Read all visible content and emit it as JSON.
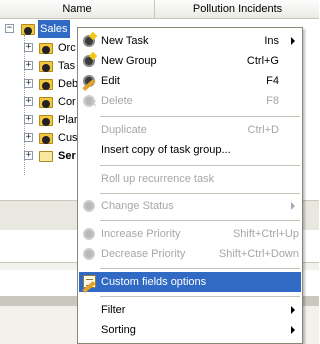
{
  "header": {
    "col_name": "Name",
    "col_pollution": "Pollution Incidents"
  },
  "tree": {
    "root_label": "Sales",
    "children": [
      {
        "label": "Orc",
        "bold": false
      },
      {
        "label": "Tas",
        "bold": false
      },
      {
        "label": "Deb",
        "bold": false
      },
      {
        "label": "Cor",
        "bold": false
      },
      {
        "label": "Plar",
        "bold": false
      },
      {
        "label": "Cus",
        "bold": false
      },
      {
        "label": "Ser",
        "bold": true
      }
    ]
  },
  "menu": {
    "new_task": {
      "label": "New Task",
      "shortcut": "Ins"
    },
    "new_group": {
      "label": "New Group",
      "shortcut": "Ctrl+G"
    },
    "edit": {
      "label": "Edit",
      "shortcut": "F4"
    },
    "delete": {
      "label": "Delete",
      "shortcut": "F8"
    },
    "duplicate": {
      "label": "Duplicate",
      "shortcut": "Ctrl+D"
    },
    "insert_copy": {
      "label": "Insert copy of task group..."
    },
    "roll_up": {
      "label": "Roll up recurrence task"
    },
    "change_status": {
      "label": "Change Status"
    },
    "increase_priority": {
      "label": "Increase Priority",
      "shortcut": "Shift+Ctrl+Up"
    },
    "decrease_priority": {
      "label": "Decrease Priority",
      "shortcut": "Shift+Ctrl+Down"
    },
    "custom_fields": {
      "label": "Custom fields options"
    },
    "filter": {
      "label": "Filter"
    },
    "sorting": {
      "label": "Sorting"
    }
  },
  "colors": {
    "highlight": "#316ac5",
    "disabled_text": "#a7a6aa",
    "separator": "#c5c2b8"
  }
}
